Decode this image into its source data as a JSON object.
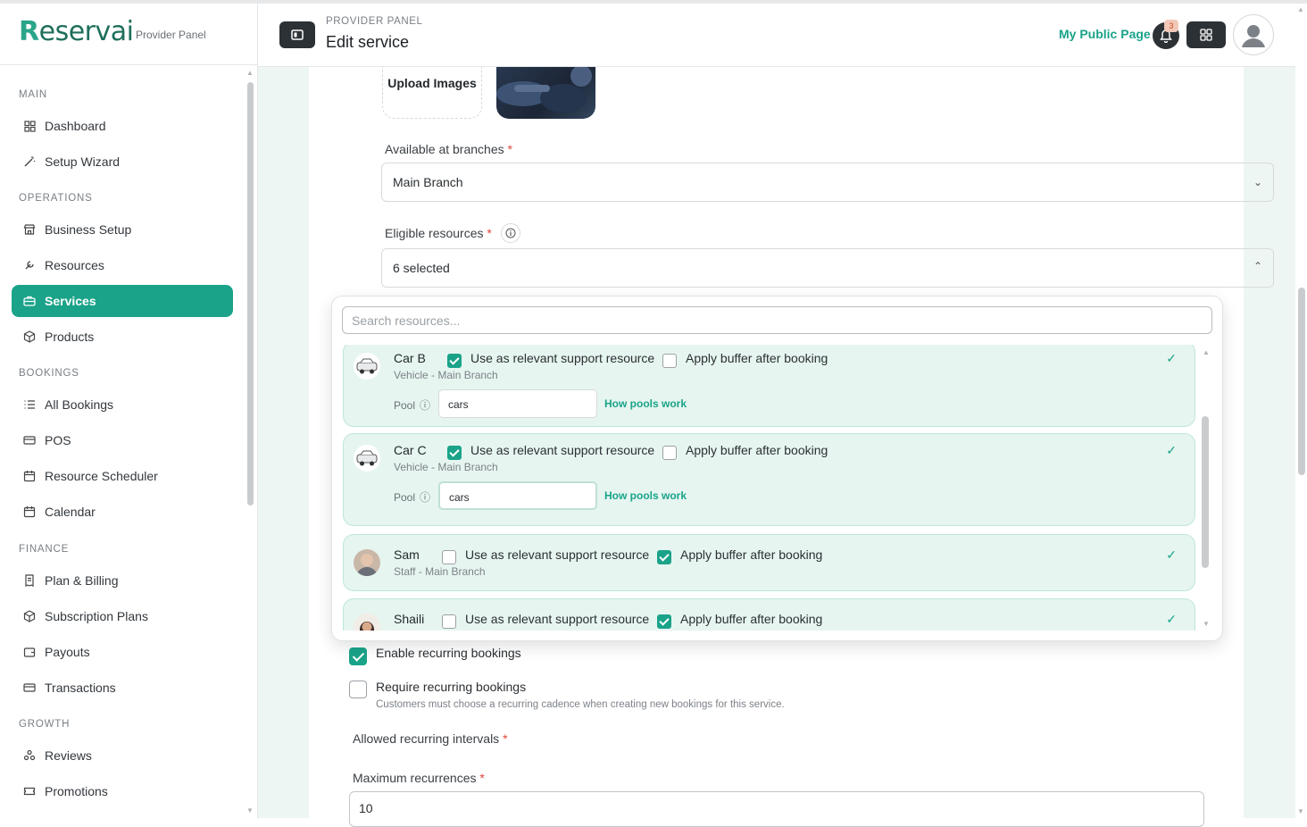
{
  "brand": {
    "logo_r": "R",
    "logo_rest": "eservai",
    "subtitle": "Provider Panel"
  },
  "sidebar": {
    "sections": [
      {
        "title": "MAIN",
        "items": [
          {
            "label": "Dashboard",
            "icon": "grid-icon"
          },
          {
            "label": "Setup Wizard",
            "icon": "wand-icon"
          }
        ]
      },
      {
        "title": "OPERATIONS",
        "items": [
          {
            "label": "Business Setup",
            "icon": "store-icon"
          },
          {
            "label": "Resources",
            "icon": "wrench-icon"
          },
          {
            "label": "Services",
            "icon": "briefcase-icon",
            "active": true
          },
          {
            "label": "Products",
            "icon": "box-icon"
          }
        ]
      },
      {
        "title": "BOOKINGS",
        "items": [
          {
            "label": "All Bookings",
            "icon": "list-icon"
          },
          {
            "label": "POS",
            "icon": "card-icon"
          },
          {
            "label": "Resource Scheduler",
            "icon": "calendar-icon"
          },
          {
            "label": "Calendar",
            "icon": "calendar-icon"
          }
        ]
      },
      {
        "title": "FINANCE",
        "items": [
          {
            "label": "Plan & Billing",
            "icon": "receipt-icon"
          },
          {
            "label": "Subscription Plans",
            "icon": "box-icon"
          },
          {
            "label": "Payouts",
            "icon": "wallet-icon"
          },
          {
            "label": "Transactions",
            "icon": "card-icon"
          }
        ]
      },
      {
        "title": "GROWTH",
        "items": [
          {
            "label": "Reviews",
            "icon": "people-icon"
          },
          {
            "label": "Promotions",
            "icon": "ticket-icon"
          }
        ]
      }
    ]
  },
  "header": {
    "crumb": "PROVIDER PANEL",
    "title": "Edit service",
    "public_link": "My Public Page",
    "notif_count": "3"
  },
  "form": {
    "upload_label": "Upload Images",
    "branches_label": "Available at branches",
    "branches_value": "Main Branch",
    "resources_label": "Eligible resources",
    "resources_value": "6 selected",
    "required_mark": "*"
  },
  "dropdown": {
    "search_placeholder": "Search resources...",
    "support_label": "Use as relevant support resource",
    "buffer_label": "Apply buffer after booking",
    "pool_label": "Pool",
    "pool_help": "How pools work",
    "resources": [
      {
        "name": "Car B",
        "sub": "Vehicle - Main Branch",
        "support": true,
        "buffer": false,
        "pool": "cars",
        "check": "✓"
      },
      {
        "name": "Car C",
        "sub": "Vehicle - Main Branch",
        "support": true,
        "buffer": false,
        "pool": "cars",
        "check": "✓"
      },
      {
        "name": "Sam",
        "sub": "Staff - Main Branch",
        "support": false,
        "buffer": true,
        "check": "✓"
      },
      {
        "name": "Shaili",
        "sub": "",
        "support": false,
        "buffer": true,
        "check": "✓"
      }
    ]
  },
  "recurring": {
    "enable_label": "Enable recurring bookings",
    "enable_checked": true,
    "require_label": "Require recurring bookings",
    "require_checked": false,
    "require_help": "Customers must choose a recurring cadence when creating new bookings for this service.",
    "intervals_label": "Allowed recurring intervals",
    "max_label": "Maximum recurrences",
    "max_value": "10"
  },
  "colors": {
    "accent": "#1aa389",
    "dark": "#2c3135",
    "required": "#e0463a"
  }
}
